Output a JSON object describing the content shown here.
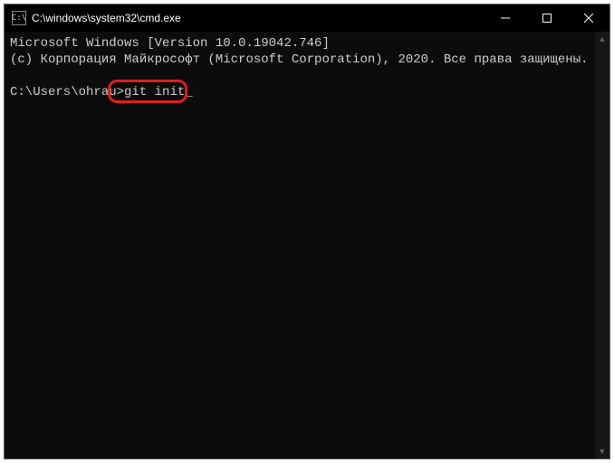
{
  "window": {
    "title": "C:\\windows\\system32\\cmd.exe",
    "icon_label": "C:\\"
  },
  "terminal": {
    "line1": "Microsoft Windows [Version 10.0.19042.746]",
    "line2": "(c) Корпорация Майкрософт (Microsoft Corporation), 2020. Все права защищены.",
    "prompt": "C:\\Users\\ohrau>",
    "command": "git init",
    "cursor": "_"
  },
  "highlight": {
    "target": "git init"
  }
}
